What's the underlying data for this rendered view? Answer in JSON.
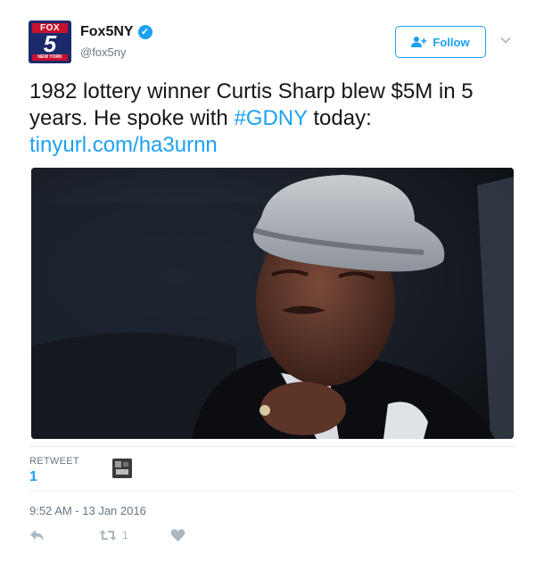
{
  "account": {
    "avatar_top": "FOX",
    "avatar_number": "5",
    "avatar_bottom": "NEW YORK",
    "name": "Fox5NY",
    "handle": "@fox5ny",
    "verified": true
  },
  "follow_button": {
    "label": "Follow"
  },
  "tweet": {
    "text_part1": "1982 lottery winner Curtis Sharp blew $5M in 5 years. He spoke with ",
    "hashtag": "#GDNY",
    "text_part2": " today: ",
    "link": "tinyurl.com/ha3urnn"
  },
  "stats": {
    "retweet_label": "RETWEET",
    "retweet_count": "1"
  },
  "timestamp": "9:52 AM - 13 Jan 2016",
  "actions": {
    "retweet_count": "1"
  },
  "colors": {
    "accent": "#1da1f2",
    "text": "#14171a",
    "muted": "#657786",
    "icon": "#aab8c2"
  }
}
